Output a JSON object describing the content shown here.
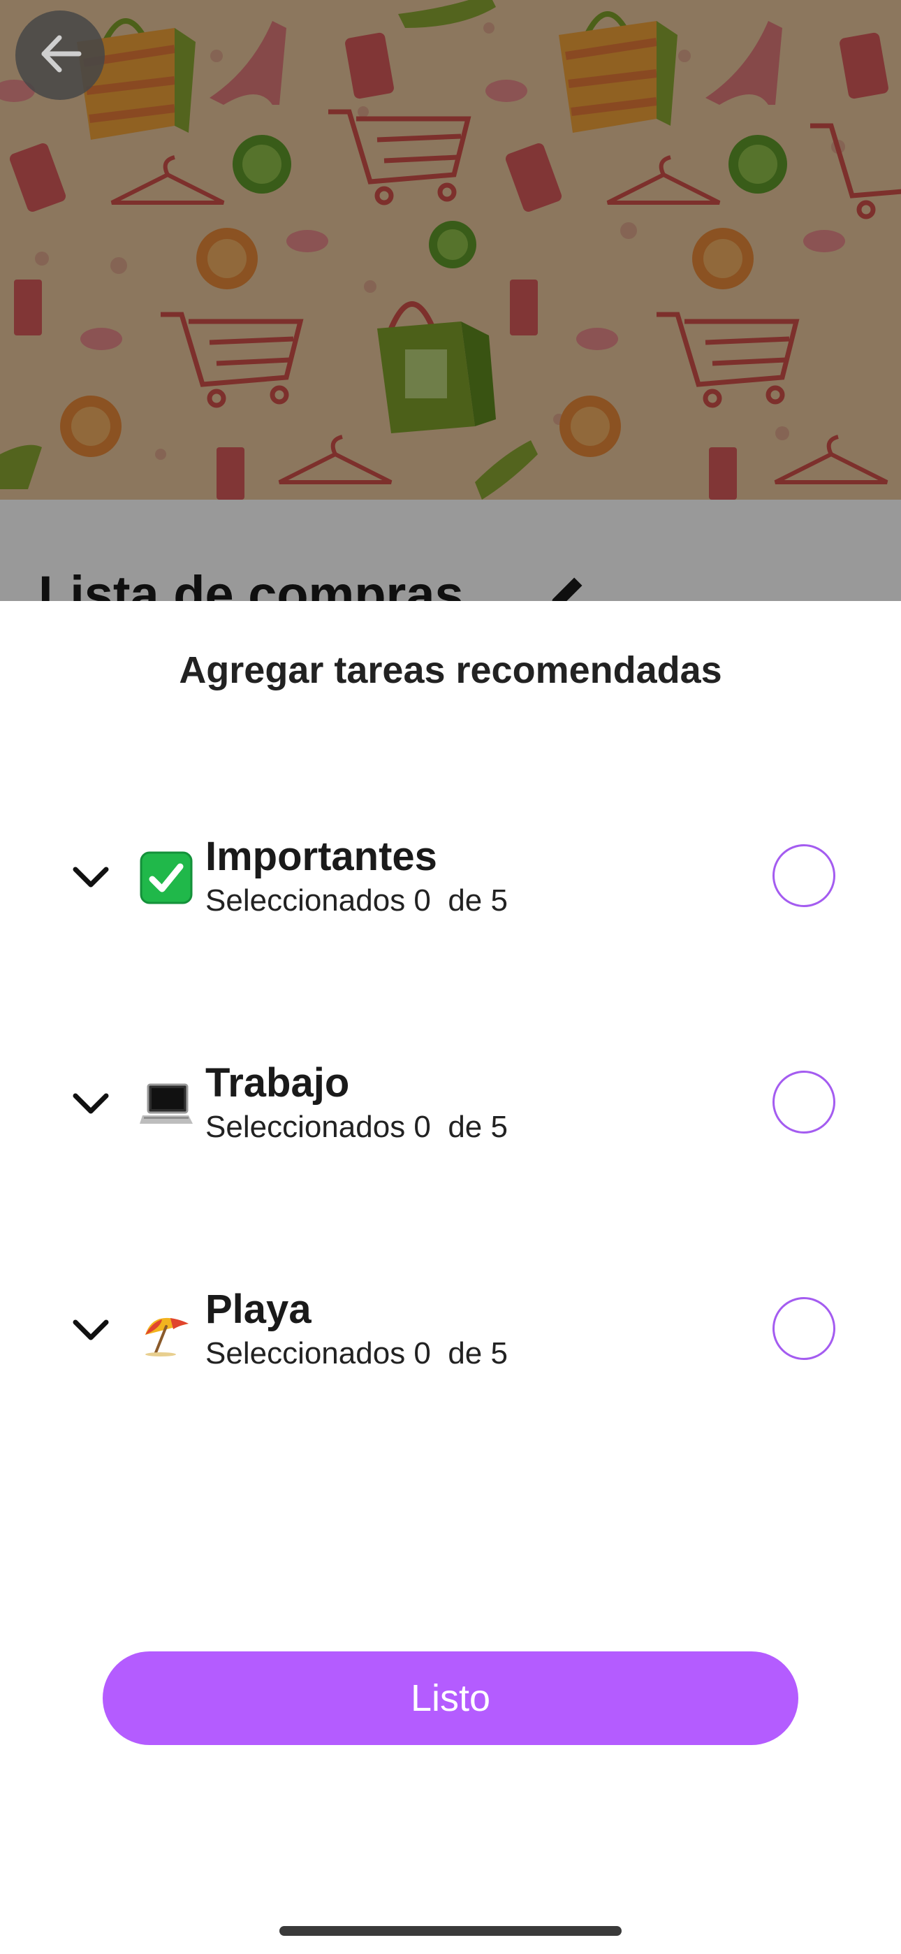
{
  "background": {
    "list_title": "Lista de compras",
    "edit_icon": "pencil-icon",
    "back_icon": "arrow-left-icon"
  },
  "sheet": {
    "title": "Agregar tareas recomendadas",
    "categories": [
      {
        "emoji": "check-box-emoji",
        "title": "Importantes",
        "subtitle": "Seleccionados 0  de 5",
        "selected": false
      },
      {
        "emoji": "laptop-emoji",
        "title": "Trabajo",
        "subtitle": "Seleccionados 0  de 5",
        "selected": false
      },
      {
        "emoji": "beach-umbrella-emoji",
        "title": "Playa",
        "subtitle": "Seleccionados 0  de 5",
        "selected": false
      }
    ],
    "done_label": "Listo"
  },
  "colors": {
    "accent": "#b45cff",
    "radio_border": "#a45cf0",
    "hero_background": "#e9c79d"
  }
}
